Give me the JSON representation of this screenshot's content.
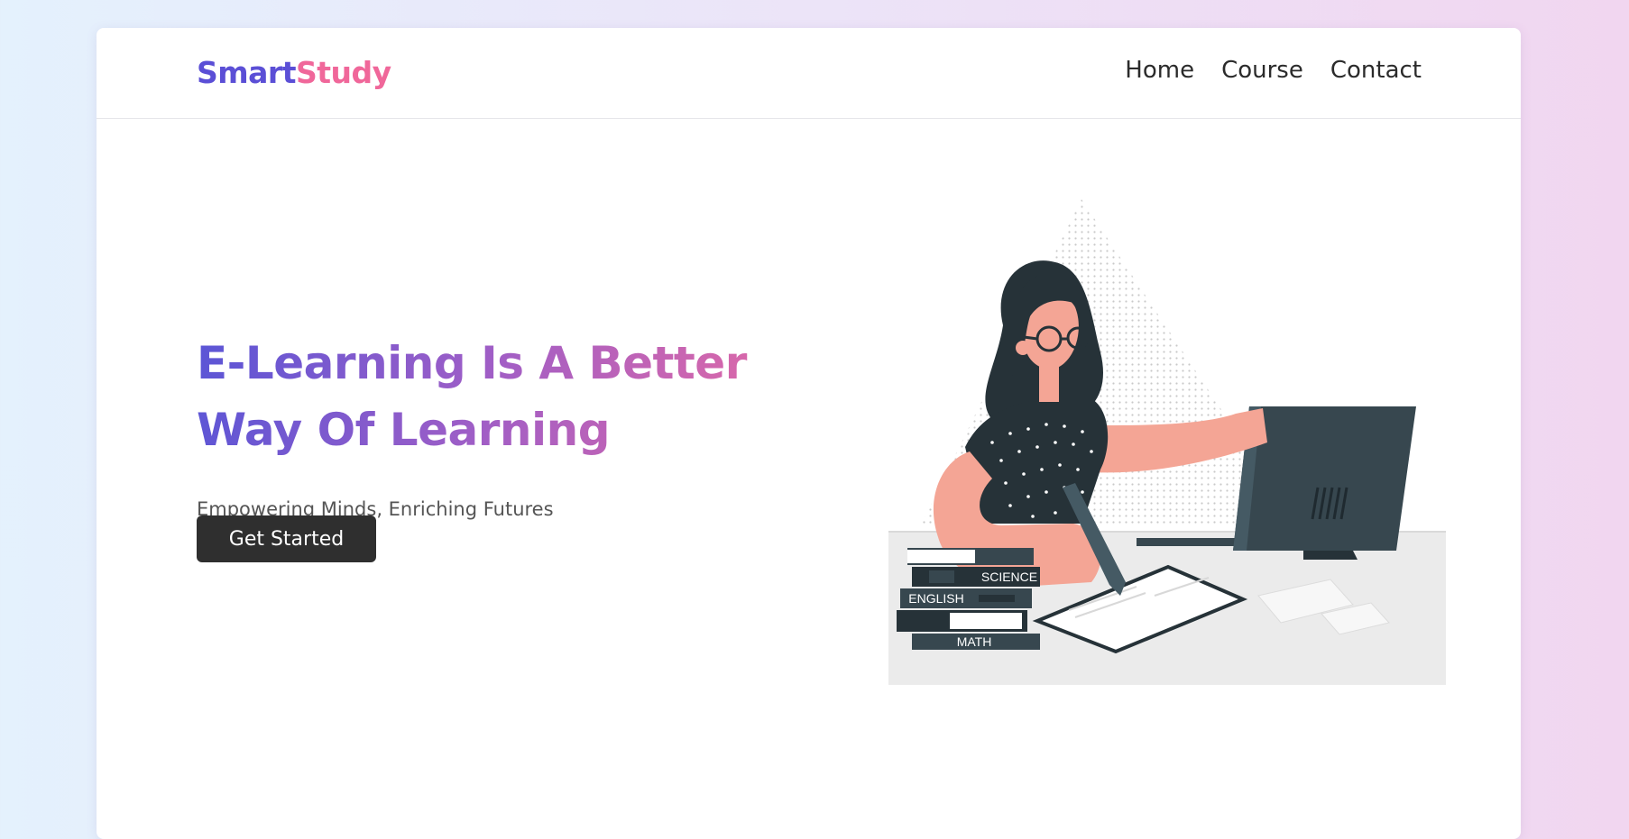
{
  "brand": {
    "part1": "Smart",
    "part2": "Study"
  },
  "nav": {
    "items": [
      "Home",
      "Course",
      "Contact"
    ]
  },
  "hero": {
    "title": "E-Learning Is A Better Way Of Learning",
    "subtitle": "Empowering Minds, Enriching Futures",
    "cta": "Get Started"
  },
  "illustration": {
    "books": [
      "SCIENCE",
      "ENGLISH",
      "MATH"
    ]
  },
  "colors": {
    "brand_purple": "#5b4fd6",
    "brand_pink": "#f0679a",
    "button_dark": "#2f2f2f",
    "skin": "#f4a595",
    "dark": "#37474f"
  }
}
